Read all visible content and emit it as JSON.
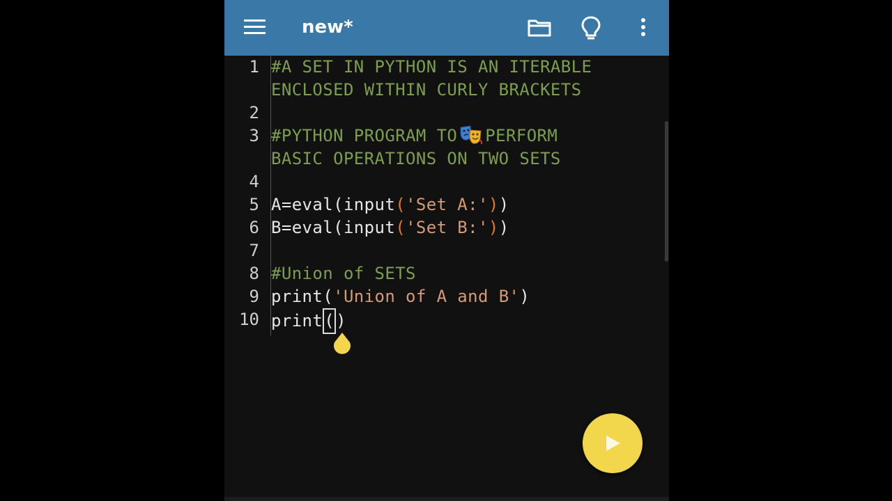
{
  "appbar": {
    "title": "new*",
    "icons": [
      "menu-icon",
      "folder-icon",
      "lightbulb-icon",
      "more-vert-icon"
    ],
    "color": "#3a78a8"
  },
  "editor": {
    "line_numbers": [
      "1",
      "2",
      "3",
      "4",
      "5",
      "6",
      "7",
      "8",
      "9",
      "10"
    ],
    "lines": {
      "l1a": "#A SET IN PYTHON IS AN ITERABLE",
      "l1b": "ENCLOSED WITHIN CURLY BRACKETS",
      "l3a_1": "#PYTHON PROGRAM TO",
      "l3a_2": "PERFORM",
      "l3b": "BASIC OPERATIONS ON TWO SETS",
      "l5_pre": "A=eval(input",
      "l5_open": "(",
      "l5_str": "'Set A:'",
      "l5_close": ")",
      "l5_post": ")",
      "l6_pre": "B=eval(input",
      "l6_open": "(",
      "l6_str": "'Set B:'",
      "l6_close": ")",
      "l6_post": ")",
      "l8": "#Union of SETS",
      "l9_pre": "print(",
      "l9_str": "'Union of A and B'",
      "l9_post": ")",
      "l10_pre": "print",
      "l10_open": "(",
      "l10_close": ")"
    },
    "colors": {
      "comment": "#7d9e4e",
      "string": "#d49b74",
      "paren": "#e07a2a",
      "text": "#e6e6e6"
    }
  },
  "run_button": {
    "icon": "play-icon",
    "color": "#f2d64b"
  }
}
